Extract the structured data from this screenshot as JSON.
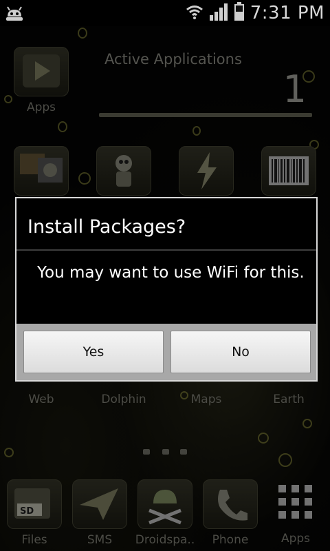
{
  "status_bar": {
    "time": "7:31 PM",
    "icons": [
      "android-notification-icon",
      "wifi-icon",
      "signal-icon",
      "battery-icon"
    ]
  },
  "widget": {
    "title": "Active Applications",
    "count": "1"
  },
  "home_icons": {
    "top": {
      "label": "Apps"
    },
    "row2": [
      {
        "label": "",
        "icon": "photo-collage-icon"
      },
      {
        "label": "",
        "icon": "robot-icon"
      },
      {
        "label": "",
        "icon": "lightning-icon"
      },
      {
        "label": "",
        "icon": "barcode-icon"
      }
    ],
    "row3": [
      {
        "label": "Web"
      },
      {
        "label": "Dolphin"
      },
      {
        "label": "Maps"
      },
      {
        "label": "Earth"
      }
    ],
    "dock": [
      {
        "label": "Files",
        "icon": "sd-card-icon"
      },
      {
        "label": "SMS",
        "icon": "paper-plane-icon"
      },
      {
        "label": "Droidspa..",
        "icon": "droid-skull-icon"
      },
      {
        "label": "Phone",
        "icon": "phone-icon"
      },
      {
        "label": "Apps",
        "icon": "grid-icon"
      }
    ]
  },
  "dialog": {
    "title": "Install Packages?",
    "message": "You may want to use WiFi for this.",
    "yes_label": "Yes",
    "no_label": "No"
  },
  "colors": {
    "dialog_border": "#d9d9d9",
    "button_bar": "#a8a8a8",
    "wallpaper_accent": "#bebe50"
  }
}
